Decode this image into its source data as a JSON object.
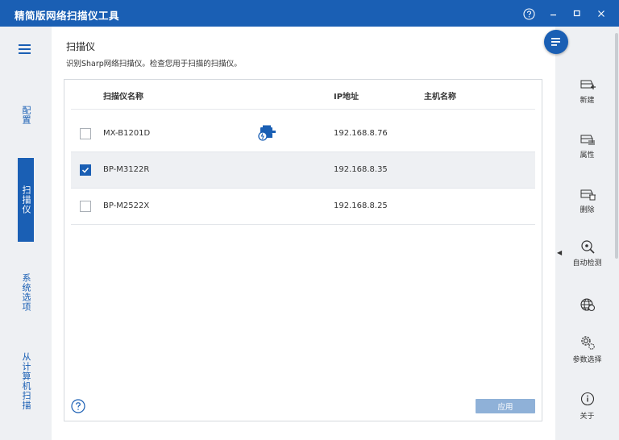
{
  "window": {
    "title": "精简版网络扫描仪工具"
  },
  "nav": {
    "items": [
      {
        "label": "配置"
      },
      {
        "label": "扫描仪"
      },
      {
        "label": "系统选项"
      },
      {
        "label": "从计算机扫描"
      }
    ]
  },
  "page": {
    "title": "扫描仪",
    "description": "识别Sharp网络扫描仪。检查您用于扫描的扫描仪。"
  },
  "table": {
    "columns": {
      "name": "扫描仪名称",
      "ip": "IP地址",
      "host": "主机名称"
    },
    "rows": [
      {
        "name": "MX-B1201D",
        "ip": "192.168.8.76",
        "host": "",
        "checked": false
      },
      {
        "name": "BP-M3122R",
        "ip": "192.168.8.35",
        "host": "",
        "checked": true
      },
      {
        "name": "BP-M2522X",
        "ip": "192.168.8.25",
        "host": "",
        "checked": false
      }
    ]
  },
  "buttons": {
    "apply": "应用"
  },
  "toolbar": {
    "new": "新建",
    "properties": "属性",
    "delete": "删除",
    "autodetect": "自动检测",
    "parameters": "参数选择",
    "about": "关于"
  },
  "colors": {
    "accent": "#1a5fb4",
    "apply_disabled": "#8fb1d8"
  }
}
